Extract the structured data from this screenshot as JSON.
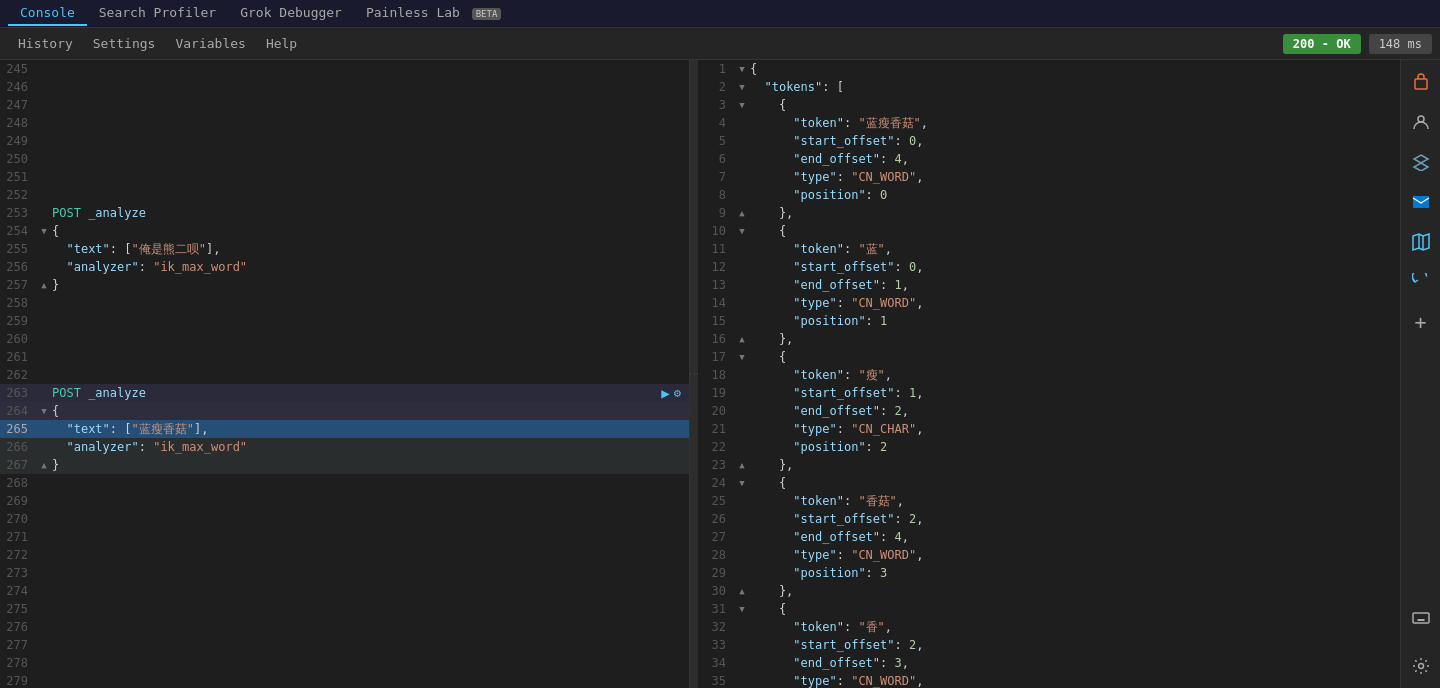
{
  "topNav": {
    "tabs": [
      {
        "label": "Console",
        "active": true
      },
      {
        "label": "Search Profiler",
        "active": false
      },
      {
        "label": "Grok Debugger",
        "active": false
      },
      {
        "label": "Painless Lab",
        "active": false,
        "beta": true
      }
    ]
  },
  "secondaryNav": {
    "items": [
      "History",
      "Settings",
      "Variables",
      "Help"
    ],
    "status": "200 - OK",
    "time": "148 ms"
  },
  "leftPane": {
    "lines": [
      {
        "num": 245,
        "gutter": "",
        "content": "",
        "highlight": false
      },
      {
        "num": 246,
        "gutter": "",
        "content": "",
        "highlight": false
      },
      {
        "num": 247,
        "gutter": "",
        "content": "",
        "highlight": false
      },
      {
        "num": 248,
        "gutter": "",
        "content": "",
        "highlight": false
      },
      {
        "num": 249,
        "gutter": "",
        "content": "",
        "highlight": false
      },
      {
        "num": 250,
        "gutter": "",
        "content": "",
        "highlight": false
      },
      {
        "num": 251,
        "gutter": "",
        "content": "",
        "highlight": false
      },
      {
        "num": 252,
        "gutter": "",
        "content": "",
        "highlight": false
      },
      {
        "num": 253,
        "gutter": "",
        "content": "POST _analyze",
        "highlight": false,
        "type": "request"
      },
      {
        "num": 254,
        "gutter": "▼",
        "content": "{",
        "highlight": false
      },
      {
        "num": 255,
        "gutter": "",
        "content": "  \"text\": [\"俺是熊二呗\"],",
        "highlight": false
      },
      {
        "num": 256,
        "gutter": "",
        "content": "  \"analyzer\": \"ik_max_word\"",
        "highlight": false
      },
      {
        "num": 257,
        "gutter": "▲",
        "content": "}",
        "highlight": false
      },
      {
        "num": 258,
        "gutter": "",
        "content": "",
        "highlight": false
      },
      {
        "num": 259,
        "gutter": "",
        "content": "",
        "highlight": false
      },
      {
        "num": 260,
        "gutter": "",
        "content": "",
        "highlight": false
      },
      {
        "num": 261,
        "gutter": "",
        "content": "",
        "highlight": false
      },
      {
        "num": 262,
        "gutter": "",
        "content": "",
        "highlight": false
      },
      {
        "num": 263,
        "gutter": "",
        "content": "POST _analyze",
        "highlight": false,
        "type": "request",
        "hasActions": true
      },
      {
        "num": 264,
        "gutter": "▼",
        "content": "{",
        "highlight": false
      },
      {
        "num": 265,
        "gutter": "",
        "content": "  \"text\": [\"蓝瘦香菇\"],",
        "highlight": true,
        "active": true
      },
      {
        "num": 266,
        "gutter": "",
        "content": "  \"analyzer\": \"ik_max_word\"",
        "highlight": true
      },
      {
        "num": 267,
        "gutter": "▲",
        "content": "}",
        "highlight": true
      },
      {
        "num": 268,
        "gutter": "",
        "content": "",
        "highlight": false
      },
      {
        "num": 269,
        "gutter": "",
        "content": "",
        "highlight": false
      },
      {
        "num": 270,
        "gutter": "",
        "content": "",
        "highlight": false
      },
      {
        "num": 271,
        "gutter": "",
        "content": "",
        "highlight": false
      },
      {
        "num": 272,
        "gutter": "",
        "content": "",
        "highlight": false
      },
      {
        "num": 273,
        "gutter": "",
        "content": "",
        "highlight": false
      },
      {
        "num": 274,
        "gutter": "",
        "content": "",
        "highlight": false
      },
      {
        "num": 275,
        "gutter": "",
        "content": "",
        "highlight": false
      },
      {
        "num": 276,
        "gutter": "",
        "content": "",
        "highlight": false
      },
      {
        "num": 277,
        "gutter": "",
        "content": "",
        "highlight": false
      },
      {
        "num": 278,
        "gutter": "",
        "content": "",
        "highlight": false
      },
      {
        "num": 279,
        "gutter": "",
        "content": "",
        "highlight": false
      }
    ]
  },
  "rightPane": {
    "lines": [
      {
        "num": 1,
        "gutter": "▼",
        "content": "{"
      },
      {
        "num": 2,
        "gutter": "▼",
        "content": "  \"tokens\": ["
      },
      {
        "num": 3,
        "gutter": "▼",
        "content": "    {"
      },
      {
        "num": 4,
        "gutter": "",
        "content": "      \"token\": \"蓝瘦香菇\","
      },
      {
        "num": 5,
        "gutter": "",
        "content": "      \"start_offset\": 0,"
      },
      {
        "num": 6,
        "gutter": "",
        "content": "      \"end_offset\": 4,"
      },
      {
        "num": 7,
        "gutter": "",
        "content": "      \"type\": \"CN_WORD\","
      },
      {
        "num": 8,
        "gutter": "",
        "content": "      \"position\": 0"
      },
      {
        "num": 9,
        "gutter": "▲",
        "content": "    },"
      },
      {
        "num": 10,
        "gutter": "▼",
        "content": "    {"
      },
      {
        "num": 11,
        "gutter": "",
        "content": "      \"token\": \"蓝\","
      },
      {
        "num": 12,
        "gutter": "",
        "content": "      \"start_offset\": 0,"
      },
      {
        "num": 13,
        "gutter": "",
        "content": "      \"end_offset\": 1,"
      },
      {
        "num": 14,
        "gutter": "",
        "content": "      \"type\": \"CN_WORD\","
      },
      {
        "num": 15,
        "gutter": "",
        "content": "      \"position\": 1"
      },
      {
        "num": 16,
        "gutter": "▲",
        "content": "    },"
      },
      {
        "num": 17,
        "gutter": "▼",
        "content": "    {"
      },
      {
        "num": 18,
        "gutter": "",
        "content": "      \"token\": \"瘦\","
      },
      {
        "num": 19,
        "gutter": "",
        "content": "      \"start_offset\": 1,"
      },
      {
        "num": 20,
        "gutter": "",
        "content": "      \"end_offset\": 2,"
      },
      {
        "num": 21,
        "gutter": "",
        "content": "      \"type\": \"CN_CHAR\","
      },
      {
        "num": 22,
        "gutter": "",
        "content": "      \"position\": 2"
      },
      {
        "num": 23,
        "gutter": "▲",
        "content": "    },"
      },
      {
        "num": 24,
        "gutter": "▼",
        "content": "    {"
      },
      {
        "num": 25,
        "gutter": "",
        "content": "      \"token\": \"香菇\","
      },
      {
        "num": 26,
        "gutter": "",
        "content": "      \"start_offset\": 2,"
      },
      {
        "num": 27,
        "gutter": "",
        "content": "      \"end_offset\": 4,"
      },
      {
        "num": 28,
        "gutter": "",
        "content": "      \"type\": \"CN_WORD\","
      },
      {
        "num": 29,
        "gutter": "",
        "content": "      \"position\": 3"
      },
      {
        "num": 30,
        "gutter": "▲",
        "content": "    },"
      },
      {
        "num": 31,
        "gutter": "▼",
        "content": "    {"
      },
      {
        "num": 32,
        "gutter": "",
        "content": "      \"token\": \"香\","
      },
      {
        "num": 33,
        "gutter": "",
        "content": "      \"start_offset\": 2,"
      },
      {
        "num": 34,
        "gutter": "",
        "content": "      \"end_offset\": 3,"
      },
      {
        "num": 35,
        "gutter": "",
        "content": "      \"type\": \"CN_WORD\","
      }
    ]
  },
  "sidebarRight": {
    "icons": [
      {
        "name": "user-icon",
        "symbol": "👤"
      },
      {
        "name": "layers-icon",
        "symbol": "⬡"
      },
      {
        "name": "outlook-icon",
        "symbol": "📧"
      },
      {
        "name": "map-icon",
        "symbol": "🗺"
      },
      {
        "name": "refresh-icon",
        "symbol": "↻"
      },
      {
        "name": "add-icon",
        "symbol": "+"
      }
    ],
    "bottomIcons": [
      {
        "name": "keyboard-icon",
        "symbol": "⌨"
      },
      {
        "name": "settings-icon",
        "symbol": "⚙"
      }
    ]
  }
}
